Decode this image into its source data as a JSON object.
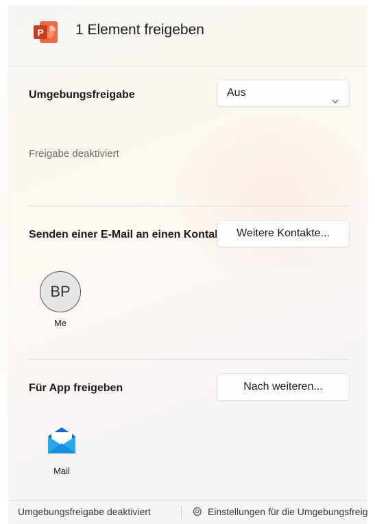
{
  "header": {
    "app_icon": "powerpoint-icon",
    "title": "1 Element freigeben"
  },
  "nearby_sharing": {
    "label": "Umgebungsfreigabe",
    "dropdown_value": "Aus",
    "dropdown_icon": "chevron-down-icon",
    "status": "Freigabe deaktiviert"
  },
  "email_contacts": {
    "label": "Senden einer E-Mail an einen Kontakt",
    "more_button": "Weitere Kontakte...",
    "contacts": [
      {
        "initials": "BP",
        "name": "Me"
      }
    ]
  },
  "share_to_app": {
    "label": "Für App freigeben",
    "more_button": "Nach weiteren...",
    "apps": [
      {
        "name": "Mail",
        "icon": "mail-icon"
      }
    ]
  },
  "footer": {
    "status": "Umgebungsfreigabe deaktiviert",
    "settings_icon": "gear-icon",
    "settings_link": "Einstellungen für die Umgebungsfreigabe"
  },
  "colors": {
    "powerpoint_red": "#c43e1c",
    "mail_blue": "#1a8ad4"
  }
}
